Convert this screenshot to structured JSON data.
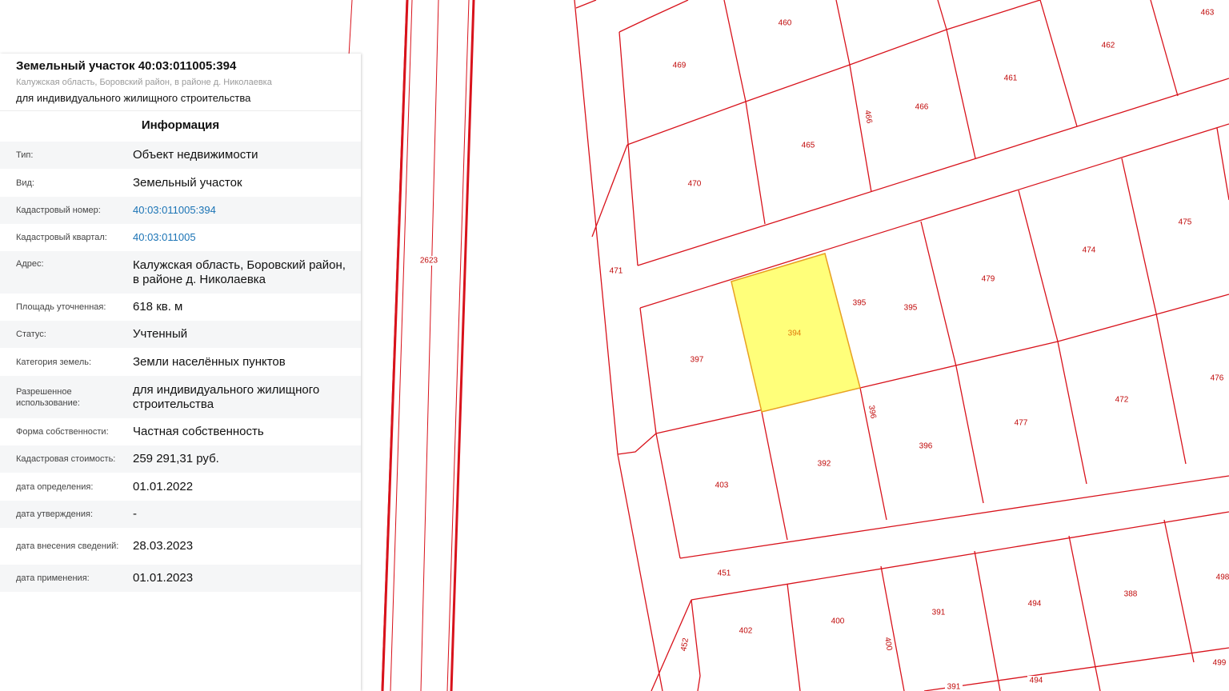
{
  "panel": {
    "title": "Земельный участок 40:03:011005:394",
    "address": "Калужская область, Боровский район, в районе д. Николаевка",
    "usage": "для индивидуального жилищного строительства",
    "section_title": "Информация",
    "rows": [
      {
        "label": "Тип:",
        "value": "Объект недвижимости"
      },
      {
        "label": "Вид:",
        "value": "Земельный участок"
      },
      {
        "label": "Кадастровый номер:",
        "value": "40:03:011005:394"
      },
      {
        "label": "Кадастровый квартал:",
        "value": "40:03:011005"
      },
      {
        "label": "Адрес:",
        "value": "Калужская область, Боровский район, в районе д. Николаевка"
      },
      {
        "label": "Площадь уточненная:",
        "value": "618 кв. м"
      },
      {
        "label": "Статус:",
        "value": "Учтенный"
      },
      {
        "label": "Категория земель:",
        "value": "Земли населённых пунктов"
      },
      {
        "label": "Разрешенное использование:",
        "value": "для индивидуального жилищного строительства"
      },
      {
        "label": "Форма собственности:",
        "value": "Частная собственность"
      },
      {
        "label": "Кадастровая стоимость:",
        "value": "259 291,31 руб."
      },
      {
        "label": "дата определения:",
        "value": "01.01.2022"
      },
      {
        "label": "дата утверждения:",
        "value": "-"
      },
      {
        "label": "дата внесения сведений:",
        "value": "28.03.2023"
      },
      {
        "label": "дата применения:",
        "value": "01.01.2023"
      }
    ]
  },
  "map": {
    "colors": {
      "boundary": "#d8121b",
      "selected_fill": "#ffff7a",
      "selected_stroke": "#e8a020",
      "label": "#c00a0a"
    },
    "parcel_labels": {
      "463": "463",
      "460": "460",
      "462": "462",
      "469": "469",
      "461": "461",
      "466a": "466",
      "466b": "466",
      "465": "465",
      "470": "470",
      "475": "475",
      "474": "474",
      "2623": "2623",
      "471": "471",
      "479": "479",
      "395a": "395",
      "395b": "395",
      "394": "394",
      "397": "397",
      "476": "476",
      "472": "472",
      "396a": "396",
      "477": "477",
      "396b": "396",
      "392": "392",
      "403": "403",
      "451": "451",
      "498": "498",
      "388": "388",
      "494a": "494",
      "391a": "391",
      "400a": "400",
      "402": "402",
      "400b": "400",
      "452": "452",
      "499": "499",
      "494b": "494",
      "391b": "391"
    }
  }
}
